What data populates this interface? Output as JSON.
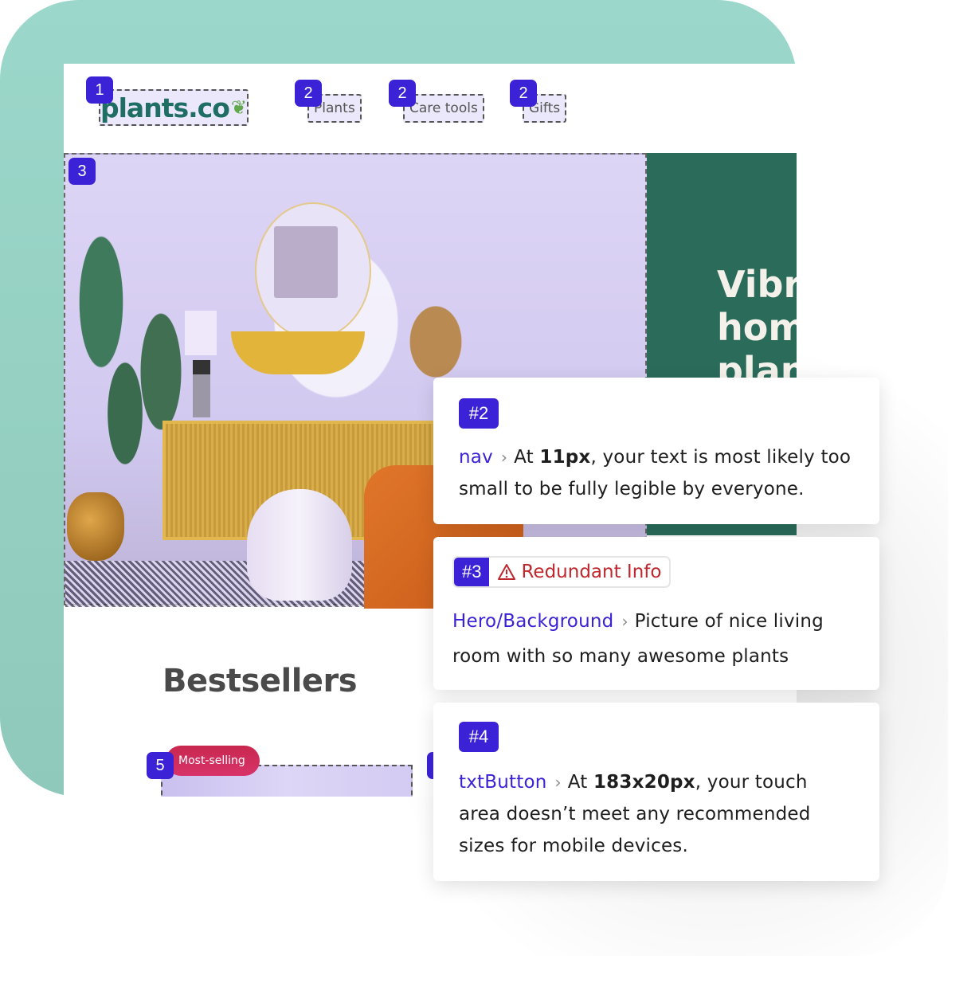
{
  "site": {
    "logo_text": "plants.co",
    "logo_icon": "leaf-icon",
    "nav": [
      {
        "label": "Plants",
        "badge": "2"
      },
      {
        "label": "Care tools",
        "badge": "2"
      },
      {
        "label": "Gifts",
        "badge": "2"
      }
    ],
    "logo_badge": "1",
    "hero_badge": "3",
    "hero_title": "Vibr\nhom\nplan",
    "section_title": "Bestsellers",
    "product_badge": "5",
    "product_ribbon": "Most-selling"
  },
  "issues": [
    {
      "id": "#2",
      "component": "nav",
      "text_before": "At ",
      "bold": "11px",
      "text_after": ", your text is most likely too small to be fully legible by everyone."
    },
    {
      "id": "#3",
      "tag": "Redundant Info",
      "tag_icon": "warning-icon",
      "component": "Hero/Background",
      "text_before": "Picture of nice living room with so many awesome plants"
    },
    {
      "id": "#4",
      "component": "txtButton",
      "text_before": "At ",
      "bold": "183x20px",
      "text_after": ", your touch area doesn’t meet any recommended sizes for mobile devices."
    }
  ],
  "colors": {
    "accent": "#3b22d6",
    "brand_green": "#2a6b5a",
    "teal_bg": "#9bd7ca",
    "warning_red": "#c0262d",
    "ribbon": "#d02f5c"
  }
}
